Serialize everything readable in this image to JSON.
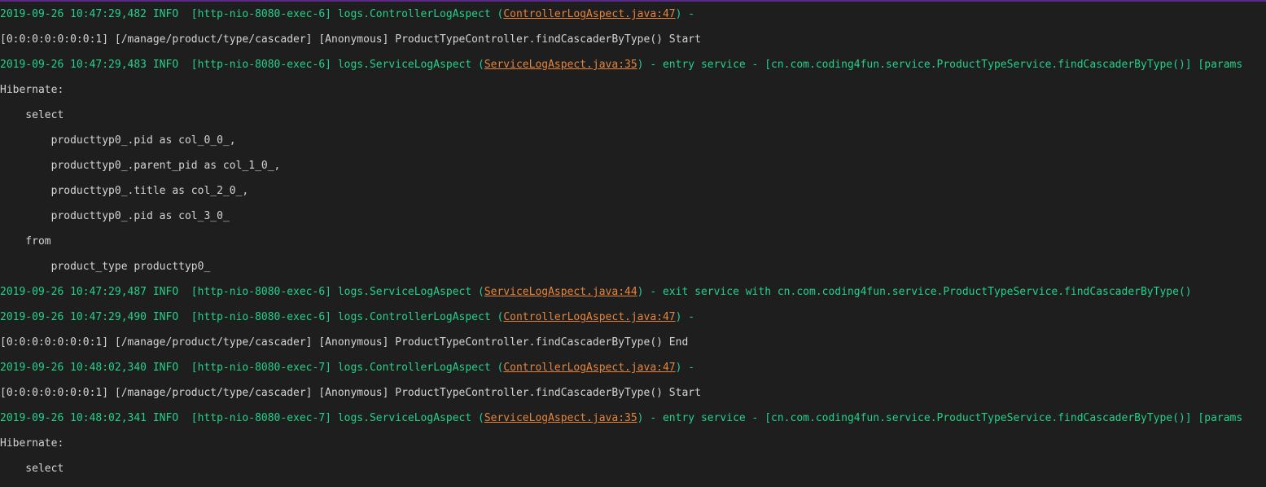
{
  "colors": {
    "background": "#1e1e1e",
    "info_text": "#23d18b",
    "plain_text": "#d4d4d4",
    "link": "#e5843b",
    "top_border": "#5b2a86"
  },
  "log_lines": [
    {
      "type": "info",
      "prefix": "2019-09-26 10:47:29,482 INFO  [http-nio-8080-exec-6] logs.ControllerLogAspect (",
      "link": "ControllerLogAspect.java:47",
      "suffix": ") -"
    },
    {
      "type": "plain",
      "text": "[0:0:0:0:0:0:0:1] [/manage/product/type/cascader] [Anonymous] ProductTypeController.findCascaderByType() Start"
    },
    {
      "type": "info",
      "prefix": "2019-09-26 10:47:29,483 INFO  [http-nio-8080-exec-6] logs.ServiceLogAspect (",
      "link": "ServiceLogAspect.java:35",
      "suffix": ") - entry service - [cn.com.coding4fun.service.ProductTypeService.findCascaderByType()] [params"
    },
    {
      "type": "plain",
      "text": "Hibernate:"
    },
    {
      "type": "plain",
      "text": "    select"
    },
    {
      "type": "plain",
      "text": "        producttyp0_.pid as col_0_0_,"
    },
    {
      "type": "plain",
      "text": "        producttyp0_.parent_pid as col_1_0_,"
    },
    {
      "type": "plain",
      "text": "        producttyp0_.title as col_2_0_,"
    },
    {
      "type": "plain",
      "text": "        producttyp0_.pid as col_3_0_"
    },
    {
      "type": "plain",
      "text": "    from"
    },
    {
      "type": "plain",
      "text": "        product_type producttyp0_"
    },
    {
      "type": "info",
      "prefix": "2019-09-26 10:47:29,487 INFO  [http-nio-8080-exec-6] logs.ServiceLogAspect (",
      "link": "ServiceLogAspect.java:44",
      "suffix": ") - exit service with cn.com.coding4fun.service.ProductTypeService.findCascaderByType()"
    },
    {
      "type": "info",
      "prefix": "2019-09-26 10:47:29,490 INFO  [http-nio-8080-exec-6] logs.ControllerLogAspect (",
      "link": "ControllerLogAspect.java:47",
      "suffix": ") -"
    },
    {
      "type": "plain",
      "text": "[0:0:0:0:0:0:0:1] [/manage/product/type/cascader] [Anonymous] ProductTypeController.findCascaderByType() End"
    },
    {
      "type": "info",
      "prefix": "2019-09-26 10:48:02,340 INFO  [http-nio-8080-exec-7] logs.ControllerLogAspect (",
      "link": "ControllerLogAspect.java:47",
      "suffix": ") -"
    },
    {
      "type": "plain",
      "text": "[0:0:0:0:0:0:0:1] [/manage/product/type/cascader] [Anonymous] ProductTypeController.findCascaderByType() Start"
    },
    {
      "type": "info",
      "prefix": "2019-09-26 10:48:02,341 INFO  [http-nio-8080-exec-7] logs.ServiceLogAspect (",
      "link": "ServiceLogAspect.java:35",
      "suffix": ") - entry service - [cn.com.coding4fun.service.ProductTypeService.findCascaderByType()] [params"
    },
    {
      "type": "plain",
      "text": "Hibernate:"
    },
    {
      "type": "plain",
      "text": "    select"
    }
  ]
}
